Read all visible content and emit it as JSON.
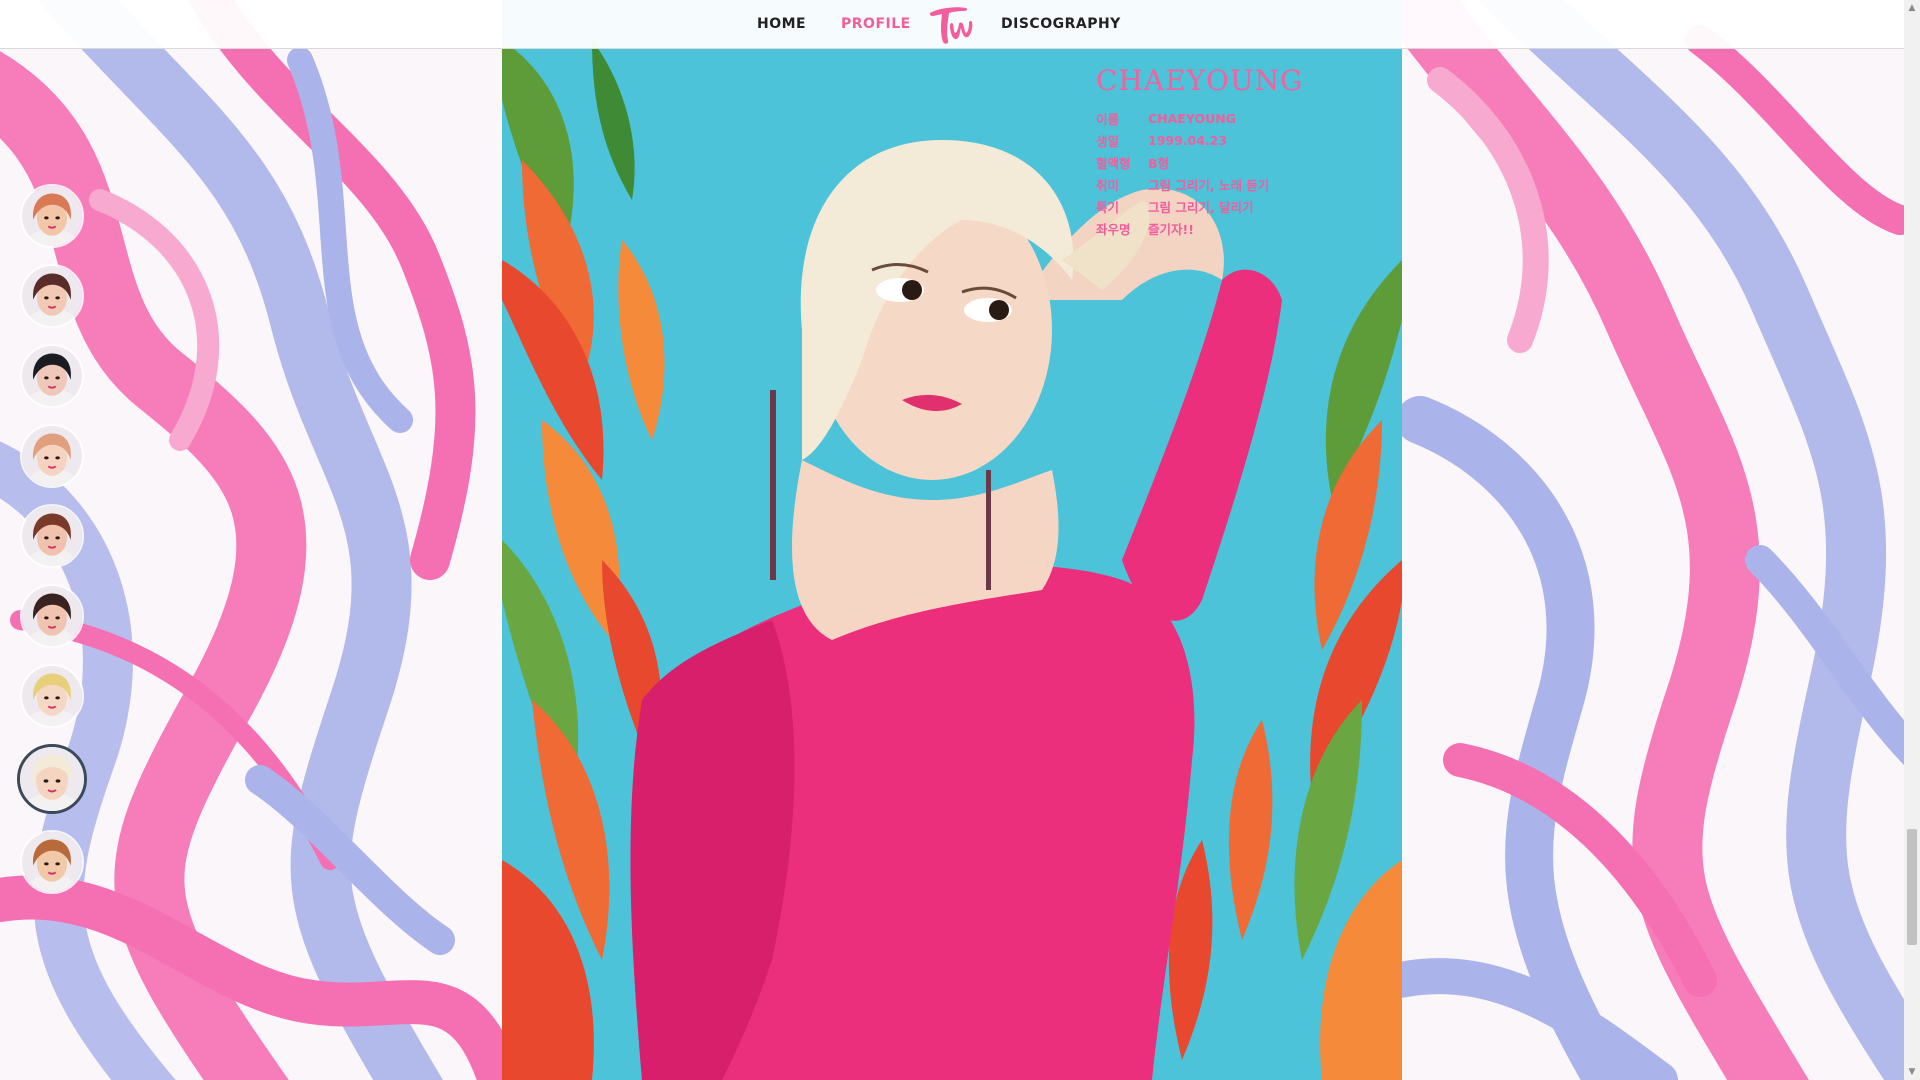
{
  "nav": {
    "home": "HOME",
    "profile": "PROFILE",
    "discography": "DISCOGRAPHY",
    "logo_icon": "twice-logo-icon",
    "active_color": "#f25d9c"
  },
  "profile": {
    "title": "CHAEYOUNG",
    "rows": [
      {
        "key": "이름",
        "value": "CHAEYOUNG"
      },
      {
        "key": "생일",
        "value": "1999.04.23"
      },
      {
        "key": "혈액형",
        "value": "B형"
      },
      {
        "key": "취미",
        "value": "그림 그리기, 노래 듣기"
      },
      {
        "key": "특기",
        "value": "그림 그리기, 달리기"
      },
      {
        "key": "좌우명",
        "value": "즐기자!!"
      }
    ],
    "accent": "#f25d9c"
  },
  "members": [
    {
      "id": "member-1",
      "active": false,
      "tone": "#f3c6a8",
      "hair": "#d97a55"
    },
    {
      "id": "member-2",
      "active": false,
      "tone": "#f2c9b4",
      "hair": "#5a2c2a"
    },
    {
      "id": "member-3",
      "active": false,
      "tone": "#efc8ba",
      "hair": "#1b1b22"
    },
    {
      "id": "member-4",
      "active": false,
      "tone": "#f6d2c0",
      "hair": "#e0a07e"
    },
    {
      "id": "member-5",
      "active": false,
      "tone": "#f1c3ae",
      "hair": "#7a3a2a"
    },
    {
      "id": "member-6",
      "active": false,
      "tone": "#f0c4b0",
      "hair": "#3a2220"
    },
    {
      "id": "member-7",
      "active": false,
      "tone": "#f4d8c4",
      "hair": "#e8d07a"
    },
    {
      "id": "member-8",
      "active": true,
      "tone": "#f5d5c0",
      "hair": "#f3ead8"
    },
    {
      "id": "member-9",
      "active": false,
      "tone": "#f1c8a8",
      "hair": "#b86a3a"
    }
  ],
  "colors": {
    "marble_pink": "#f56fb3",
    "marble_lavender": "#aab4ea",
    "photo_bg": "#4cc3d8",
    "dress": "#ec2f7c"
  }
}
